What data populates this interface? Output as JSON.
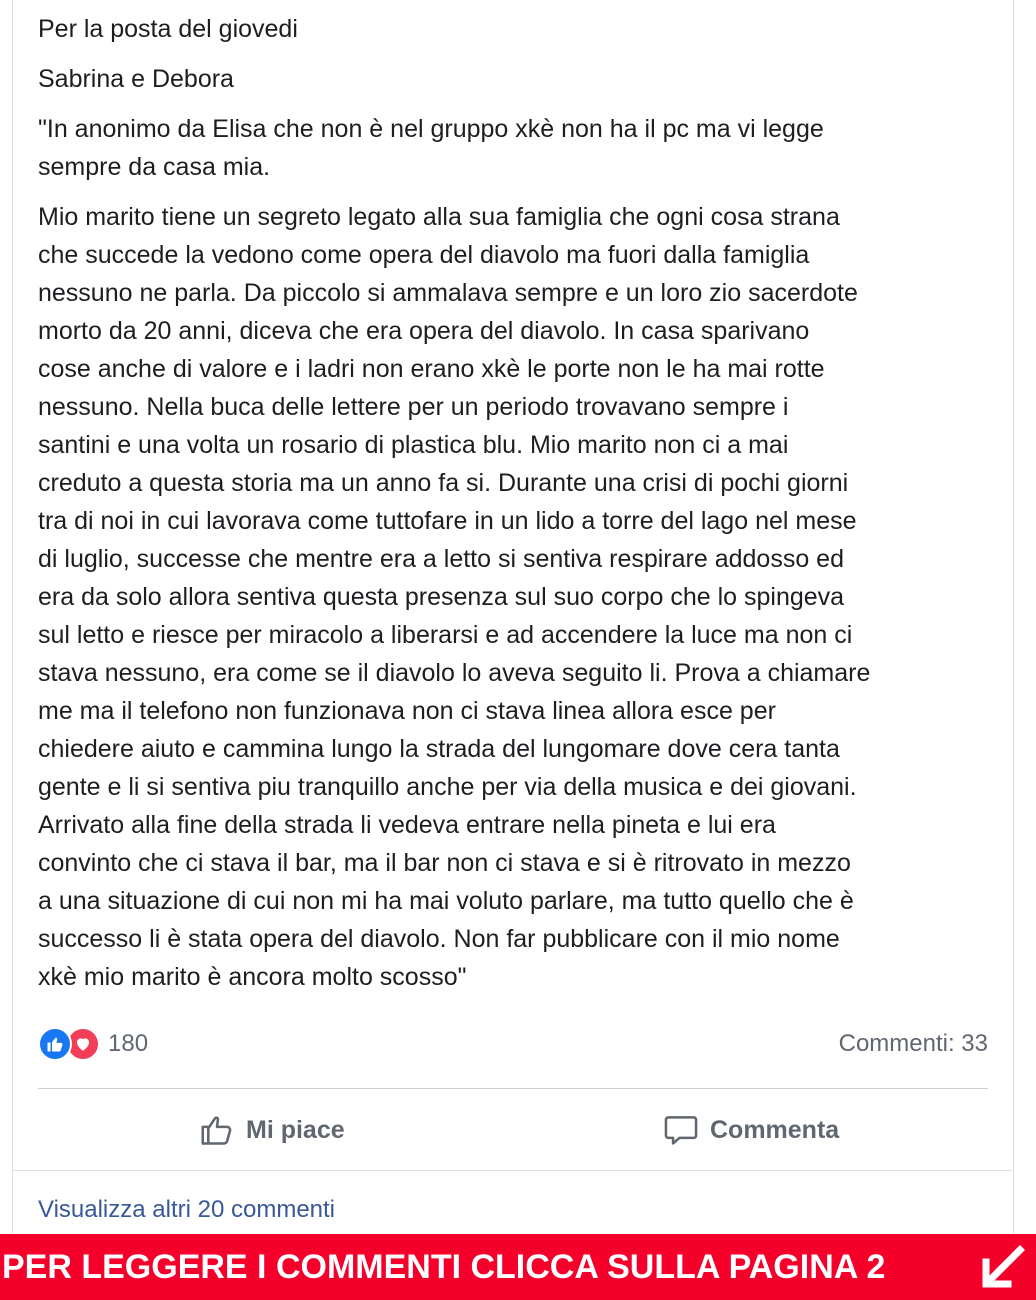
{
  "post": {
    "paragraphs": [
      "Per la posta del giovedi",
      "Sabrina e Debora",
      "\"In anonimo da Elisa che non è nel gruppo xkè non ha il pc ma vi legge\nsempre da casa mia.",
      "Mio marito tiene un segreto legato alla sua famiglia che ogni cosa strana\nche succede la vedono come opera del diavolo ma fuori dalla famiglia\nnessuno ne parla. Da piccolo si ammalava sempre e un loro zio sacerdote\nmorto da 20 anni, diceva che era opera del diavolo. In casa sparivano\ncose anche di valore e i ladri non erano xkè le porte non le ha mai rotte\nnessuno. Nella buca delle lettere per un periodo trovavano sempre i\nsantini e una volta un rosario di plastica blu. Mio marito non ci a mai\ncreduto a questa storia ma un anno fa si. Durante una crisi di pochi giorni\ntra di noi in cui lavorava come tuttofare in un lido a torre del lago nel mese\ndi luglio, successe che mentre era a letto si sentiva respirare addosso ed\nera da solo allora sentiva questa presenza sul suo corpo che lo spingeva\nsul letto e riesce per miracolo a liberarsi e ad accendere la luce ma non ci\nstava nessuno, era come se il diavolo lo aveva seguito li. Prova a chiamare\nme ma il telefono non funzionava non ci stava linea allora esce per\nchiedere aiuto e cammina lungo la strada del lungomare dove cera tanta\ngente e li si sentiva piu tranquillo anche per via della musica e dei giovani.\nArrivato alla fine della strada li vedeva entrare nella pineta e lui era\nconvinto che ci stava il bar, ma il bar non ci stava e si è ritrovato in mezzo\na una situazione di cui non mi ha mai voluto parlare, ma tutto quello che è\nsuccesso li è stata opera del diavolo. Non far pubblicare con il mio nome\nxkè mio marito è ancora molto scosso\""
    ]
  },
  "reactions": {
    "icons": [
      "like-icon",
      "love-icon"
    ],
    "count": "180",
    "comments_label": "Commenti: 33"
  },
  "actions": {
    "like_label": "Mi piace",
    "comment_label": "Commenta"
  },
  "more_comments_label": "Visualizza altri 20 commenti",
  "banner": {
    "text": "PER LEGGERE I COMMENTI CLICCA SULLA PAGINA 2",
    "icon": "arrow-down-left-icon",
    "color": "#f5002b"
  },
  "colors": {
    "like": "#1877f2",
    "love": "#f33e58",
    "link": "#385898",
    "muted": "#606770"
  }
}
